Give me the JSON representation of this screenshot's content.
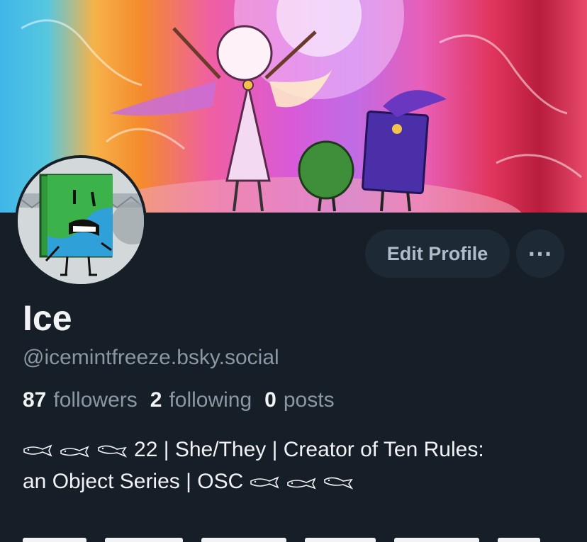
{
  "profile": {
    "display_name": "Ice",
    "handle": "@icemintfreeze.bsky.social",
    "stats": {
      "followers_count": "87",
      "followers_label": "followers",
      "following_count": "2",
      "following_label": "following",
      "posts_count": "0",
      "posts_label": "posts"
    },
    "bio": {
      "line1_text": "22 | She/They | Creator of Ten Rules:",
      "line2_text": "an Object Series | OSC"
    },
    "fish_icons": [
      "fish-icon",
      "fish-icon",
      "fish-icon"
    ]
  },
  "actions": {
    "edit_profile_label": "Edit Profile",
    "more_label": "···"
  },
  "colors": {
    "background": "#161e27",
    "button_bg": "#1e2936",
    "muted_text": "#8a97a5",
    "primary_text": "#f1f3f5"
  }
}
